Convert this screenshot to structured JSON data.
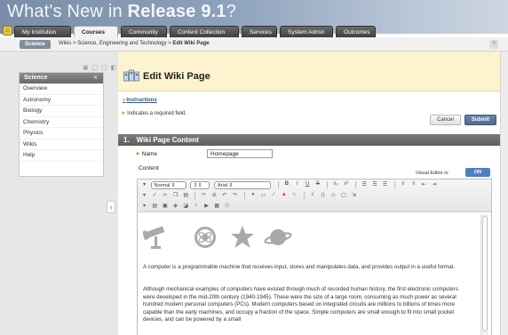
{
  "banner": {
    "title_prefix": "What's New in ",
    "title_bold": "Release 9.1",
    "title_suffix": "?"
  },
  "tabs": [
    {
      "label": "My Institution",
      "active": false
    },
    {
      "label": "Courses",
      "active": true
    },
    {
      "label": "Community",
      "active": false
    },
    {
      "label": "Content Collection",
      "active": false
    },
    {
      "label": "Services",
      "active": false
    },
    {
      "label": "System Admin",
      "active": false
    },
    {
      "label": "Outcomes",
      "active": false
    }
  ],
  "breadcrumb": {
    "pill": "Science",
    "trail_plain": "Wikis > Science, Engineering and Technology > ",
    "trail_bold": "Edit Wiki Page",
    "help": "?"
  },
  "sidebar": {
    "title": "Science",
    "items": [
      "Overview",
      "Astronomy",
      "Biology",
      "Chemistry",
      "Physics",
      "Wikis",
      "Help"
    ]
  },
  "page": {
    "title": "Edit Wiki Page",
    "instructions_link": "Instructions",
    "required_note": "Indicates a required field.",
    "cancel_label": "Cancel",
    "submit_label": "Submit"
  },
  "section": {
    "number": "1.",
    "title": "Wiki Page Content",
    "name_label": "Name",
    "name_value": "Homepage",
    "content_label": "Content",
    "visual_editor_label": "Visual Editor is:",
    "visual_editor_state": "ON"
  },
  "editor": {
    "format_select": "Normal",
    "size_select": "3",
    "font_select": "Arial",
    "paragraph_1": "A computer is a programmable machine that receives input, stores and manipulates data, and provides output in a useful format.",
    "paragraph_2": "Although mechanical examples of computers have existed through much of recorded human history, the first electronic computers were developed in the mid-20th century (1940-1945). These were the size of a large room, consuming as much power as several hundred modern personal computers (PCs). Modern computers based on integrated circuits are millions to billions of times more capable than the early machines, and occupy a fraction of the space. Simple computers are small enough to fit into small pocket devices, and can be powered by a small"
  }
}
